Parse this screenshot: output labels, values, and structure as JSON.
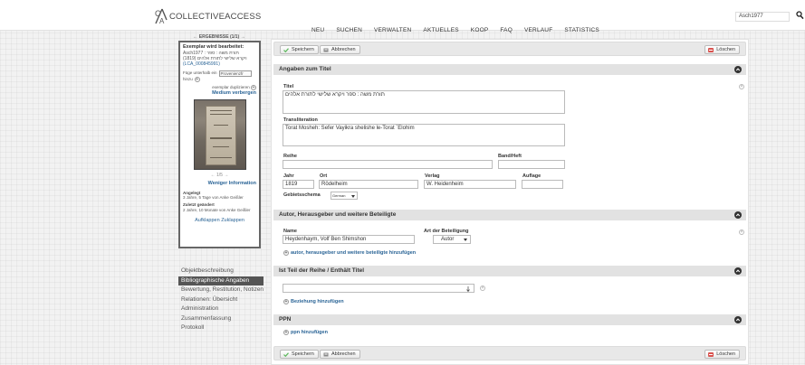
{
  "app": {
    "brand": "COLLECTIVEACCESS",
    "search_value": "Asch1977"
  },
  "nav": {
    "items": [
      "NEU",
      "SUCHEN",
      "VERWALTEN",
      "AKTUELLES",
      "KOOP",
      "FAQ",
      "VERLAUF",
      "STATISTICS"
    ]
  },
  "results_nav": "← ERGEBNISSE (1/1) →",
  "record_panel": {
    "heading": "Exemplar wird bearbeitet:",
    "id_line": "Asch1977 : תורת משה : ספר",
    "title_line": "(1819) ויקרא שלישי לתורת אלהים",
    "code": "(LCA_000845991)",
    "insert_label": "Füge unterhalb ein",
    "insert_label_2": "hinzu",
    "insert_select": "Provenienzfr",
    "duplicate": "exemplar duplizieren",
    "hide_media": "Medium verbergen",
    "img_pager": "← 1/5 →",
    "less_info": "Weniger Information",
    "created_label": "Angelegt",
    "created_value": "3 Jahre, 5 Tage von Anke Geißler",
    "modified_label": "Zuletzt geändert",
    "modified_value": "2 Jahre, 10 Monate von Anke Geißler",
    "expand": "Aufklappen",
    "collapse": "Zuklappen"
  },
  "left_nav": {
    "items": [
      "Objektbeschreibung",
      "Bibliographische Angaben",
      "Bewertung, Restitution, Notizen",
      "Relationen: Übersicht",
      "Administration",
      "Zusammenfassung",
      "Protokoll"
    ],
    "active_index": 1
  },
  "toolbar": {
    "save": "Speichern",
    "cancel": "Abbrechen",
    "delete": "Löschen"
  },
  "sections": {
    "title_info": {
      "head": "Angaben zum Titel",
      "titel_label": "Titel",
      "titel_value": "תורת משה : ספר ויקרא שלישי לתורת אלהים",
      "translit_label": "Transliteration",
      "translit_value": "Torat Mosheh: Sefer Vayikra shelishe le-Torat `Elohim",
      "reihe_label": "Reihe",
      "reihe_value": "",
      "band_label": "Band/Heft",
      "band_value": "",
      "jahr_label": "Jahr",
      "jahr_value": "1819",
      "ort_label": "Ort",
      "ort_value": "Rödelheim",
      "verlag_label": "Verlag",
      "verlag_value": "W. Heidenheim",
      "auflage_label": "Auflage",
      "auflage_value": "",
      "gebiet_label": "Gebietsschema",
      "gebiet_value": "German"
    },
    "authors": {
      "head": "Autor, Herausgeber und weitere Beteiligte",
      "name_label": "Name",
      "name_value": "Heydenhaym, Volf Ben Shimshon",
      "role_label": "Art der Beteiligung",
      "role_value": "Autor",
      "add_link": "autor, herausgeber und weitere beteiligte hinzufügen"
    },
    "series": {
      "head": "Ist Teil der Reihe / Enthält Titel",
      "add_link": "Beziehung hinzufügen"
    },
    "ppn": {
      "head": "PPN",
      "add_link": "ppn hinzufügen"
    }
  },
  "colors": {
    "accent_link": "#2a6496",
    "active_nav_bg": "#555555",
    "delete_icon": "#d9534f",
    "save_icon": "#5cb85c"
  }
}
